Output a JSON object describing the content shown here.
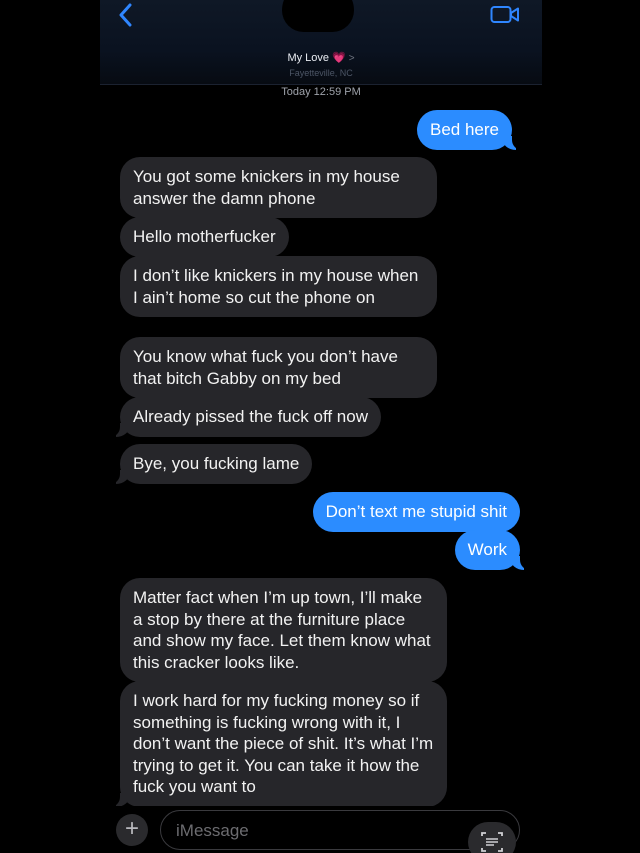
{
  "header": {
    "contact_name": "My Love",
    "heart": "💗",
    "chevron": ">",
    "location": "Fayetteville, NC",
    "timestamp": "Today 12:59 PM"
  },
  "messages": [
    {
      "direction": "sent",
      "text": "Bed here"
    },
    {
      "direction": "received",
      "text": "You got some knickers in my house answer the damn phone"
    },
    {
      "direction": "received",
      "text": "Hello motherfucker"
    },
    {
      "direction": "received",
      "text": "I don’t like knickers in my house when I ain’t home so cut the phone on"
    },
    {
      "direction": "received",
      "text": "You know what fuck you don’t have that bitch Gabby on my bed"
    },
    {
      "direction": "received",
      "text": "Already pissed the fuck off now"
    },
    {
      "direction": "received",
      "text": "Bye, you fucking lame"
    },
    {
      "direction": "sent",
      "text": "Don’t text me stupid shit"
    },
    {
      "direction": "sent",
      "text": "Work"
    },
    {
      "direction": "received",
      "text": "Matter fact when I’m up town, I’ll make a stop by there at the furniture place and show my face. Let them know what this cracker looks like."
    },
    {
      "direction": "received",
      "text": "I work hard for my fucking money so if something is fucking wrong with it, I don’t want the piece of shit. It’s what I’m trying to get it. You can take it how the fuck you want to"
    }
  ],
  "composer": {
    "plus_label": "+",
    "placeholder": "iMessage"
  },
  "icons": {
    "back": "chevron-left-icon",
    "video": "video-camera-icon",
    "scan": "text-scan-icon"
  },
  "colors": {
    "sent_bubble": "#2b8cff",
    "received_bubble": "#26262a",
    "accent": "#2f86ff",
    "heart": "#ff5fa8"
  }
}
